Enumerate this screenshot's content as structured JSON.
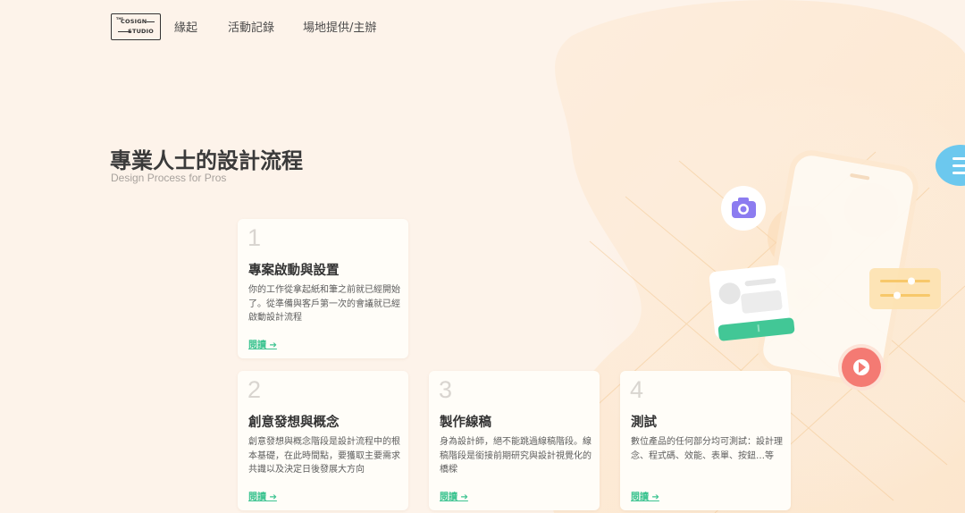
{
  "logo": {
    "the": "THE",
    "line1": "COSIGN",
    "line2": "STUDIO"
  },
  "nav": [
    {
      "label": "緣起"
    },
    {
      "label": "活動記錄"
    },
    {
      "label": "場地提供/主辦"
    }
  ],
  "section": {
    "title": "專業人士的設計流程",
    "subtitle": "Design Process for Pros"
  },
  "cards": [
    {
      "number": "1",
      "title": "專案啟動與設置",
      "desc": "你的工作從拿起紙和筆之前就已經開始了。從準備與客戶第一次的會議就已經啟動設計流程",
      "link": "閱讀 ➔"
    },
    {
      "number": "2",
      "title": "創意發想與概念",
      "desc": "創意發想與概念階段是設計流程中的根本基礎，在此時間點，要獲取主要需求共識以及決定日後發展大方向",
      "link": "閱讀 ➔"
    },
    {
      "number": "3",
      "title": "製作線稿",
      "desc": "身為設計師，絕不能跳過線稿階段。線稿階段是銜接前期研究與設計視覺化的橋樑",
      "link": "閱讀 ➔"
    },
    {
      "number": "4",
      "title": "測試",
      "desc": "數位產品的任何部分均可測試：設計理念、程式碼、效能、表單、按鈕…等",
      "link": "閱讀 ➔"
    }
  ],
  "colors": {
    "background": "#fdf3ea",
    "accent": "#3dc491",
    "card": "#fffdf8",
    "play": "#f47a73",
    "slider": "#f7c86a",
    "camera": "#8c7cf0",
    "chat": "#6cc8ee"
  },
  "icons": [
    "camera-icon",
    "play-icon",
    "slider-icon",
    "chat-bubble-icon",
    "arrow-right-icon"
  ]
}
